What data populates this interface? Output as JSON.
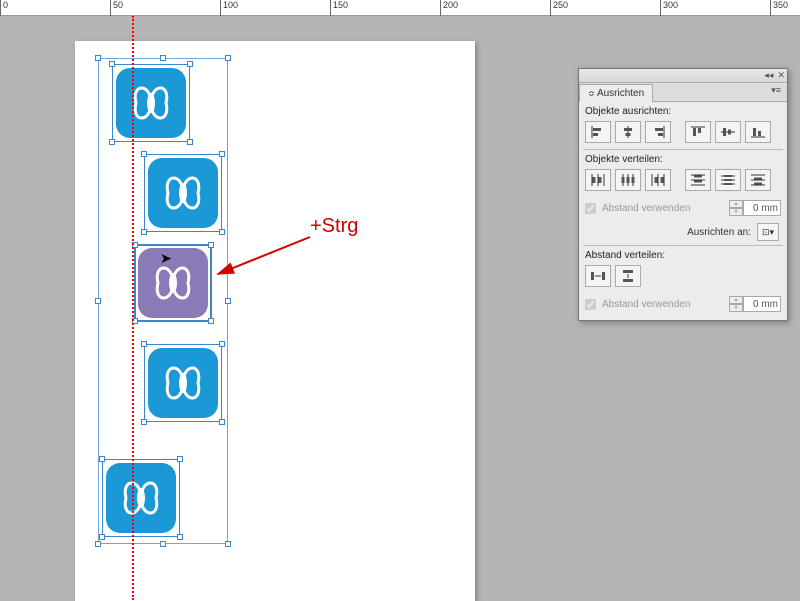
{
  "ruler": {
    "major_ticks": [
      0,
      50,
      100,
      150,
      200,
      250,
      300,
      350
    ]
  },
  "annotation": {
    "text": "+Strg"
  },
  "panel": {
    "title": "Ausrichten",
    "sections": {
      "align": "Objekte ausrichten:",
      "distribute": "Objekte verteilen:",
      "spacing": "Abstand verteilen:"
    },
    "use_spacing": "Abstand verwenden",
    "align_to_label": "Ausrichten an:",
    "spacing_value": "0 mm"
  }
}
